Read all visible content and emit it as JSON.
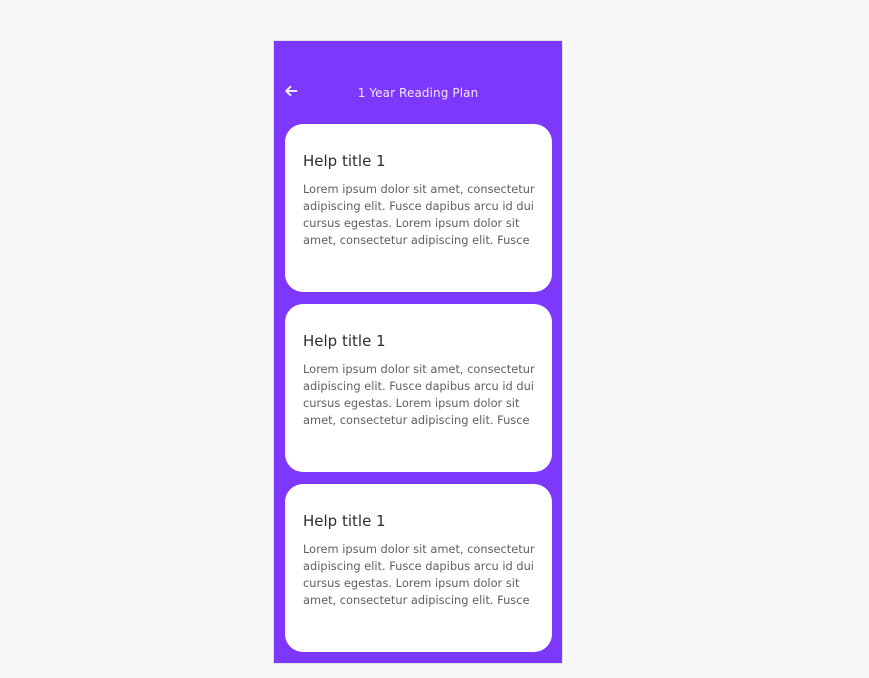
{
  "header": {
    "back_icon": "arrow-left-icon",
    "title": "1 Year Reading Plan"
  },
  "colors": {
    "page_background": "#f7f7f7",
    "app_background": "#7e38fb",
    "card_background": "#ffffff",
    "title_text": "#2d2d2d",
    "body_text": "#5f5f5f"
  },
  "cards": [
    {
      "title": "Help title 1",
      "body": "Lorem ipsum dolor sit amet, consectetur adipiscing elit. Fusce dapibus arcu id dui cursus egestas. Lorem ipsum dolor sit amet, consectetur adipiscing elit. Fusce"
    },
    {
      "title": "Help title 1",
      "body": "Lorem ipsum dolor sit amet, consectetur adipiscing elit. Fusce dapibus arcu id dui cursus egestas. Lorem ipsum dolor sit amet, consectetur adipiscing elit. Fusce"
    },
    {
      "title": "Help title 1",
      "body": "Lorem ipsum dolor sit amet, consectetur adipiscing elit. Fusce dapibus arcu id dui cursus egestas. Lorem ipsum dolor sit amet, consectetur adipiscing elit. Fusce"
    }
  ]
}
